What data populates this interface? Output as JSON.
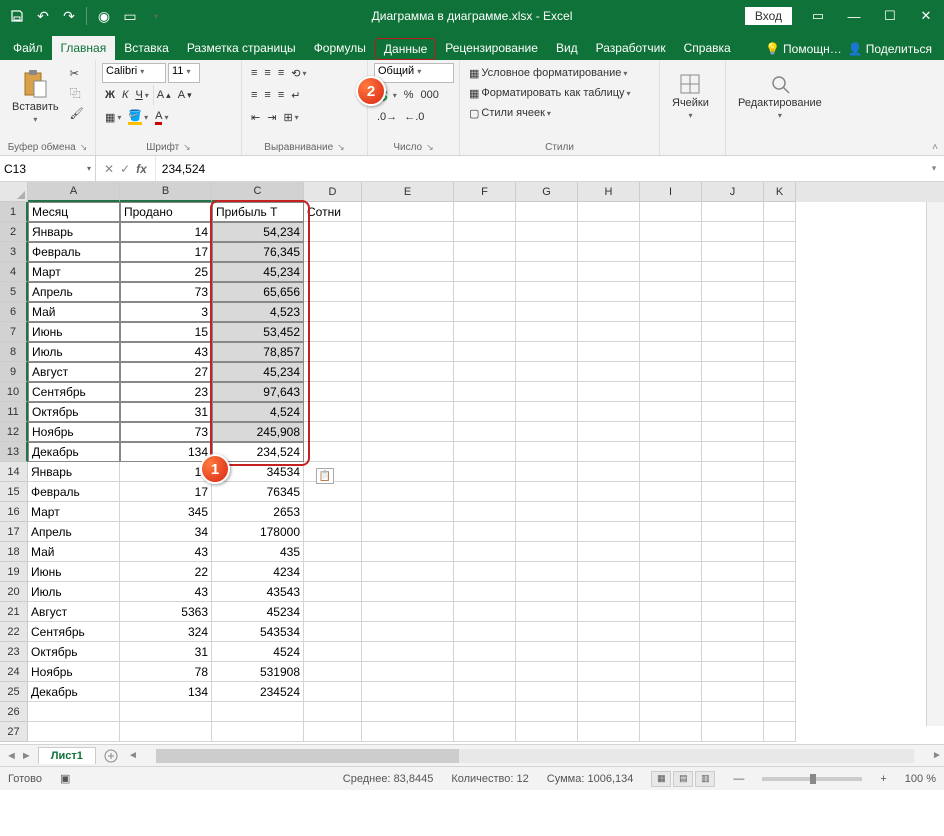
{
  "title": "Диаграмма в диаграмме.xlsx  -  Excel",
  "login": "Вход",
  "tabs": [
    "Файл",
    "Главная",
    "Вставка",
    "Разметка страницы",
    "Формулы",
    "Данные",
    "Рецензирование",
    "Вид",
    "Разработчик",
    "Справка"
  ],
  "active_tab": 1,
  "boxed_tab": 5,
  "help_label": "Помощн…",
  "share_label": "Поделиться",
  "ribbon": {
    "clipboard": {
      "paste": "Вставить",
      "label": "Буфер обмена"
    },
    "font": {
      "name": "Calibri",
      "size": "11",
      "label": "Шрифт"
    },
    "align": {
      "label": "Выравнивание"
    },
    "number": {
      "format": "Общий",
      "label": "Число"
    },
    "styles": {
      "cond": "Условное форматирование",
      "table": "Форматировать как таблицу",
      "cell": "Стили ячеек",
      "label": "Стили"
    },
    "cells": {
      "label": "Ячейки"
    },
    "editing": {
      "label": "Редактирование"
    }
  },
  "namebox": "C13",
  "formula": "234,524",
  "columns": [
    "A",
    "B",
    "C",
    "D",
    "E",
    "F",
    "G",
    "H",
    "I",
    "J",
    "K"
  ],
  "headers": {
    "A": "Месяц",
    "B": "Продано",
    "C": "Прибыль Т",
    "D": "Сотни"
  },
  "rows": [
    {
      "n": 1,
      "a": "Месяц",
      "b": "Продано",
      "c": "Прибыль Т",
      "d": "Сотни",
      "hdr": true
    },
    {
      "n": 2,
      "a": "Январь",
      "b": "14",
      "c": "54,234"
    },
    {
      "n": 3,
      "a": "Февраль",
      "b": "17",
      "c": "76,345"
    },
    {
      "n": 4,
      "a": "Март",
      "b": "25",
      "c": "45,234"
    },
    {
      "n": 5,
      "a": "Апрель",
      "b": "73",
      "c": "65,656"
    },
    {
      "n": 6,
      "a": "Май",
      "b": "3",
      "c": "4,523"
    },
    {
      "n": 7,
      "a": "Июнь",
      "b": "15",
      "c": "53,452"
    },
    {
      "n": 8,
      "a": "Июль",
      "b": "43",
      "c": "78,857"
    },
    {
      "n": 9,
      "a": "Август",
      "b": "27",
      "c": "45,234"
    },
    {
      "n": 10,
      "a": "Сентябрь",
      "b": "23",
      "c": "97,643"
    },
    {
      "n": 11,
      "a": "Октябрь",
      "b": "31",
      "c": "4,524"
    },
    {
      "n": 12,
      "a": "Ноябрь",
      "b": "73",
      "c": "245,908"
    },
    {
      "n": 13,
      "a": "Декабрь",
      "b": "134",
      "c": "234,524"
    },
    {
      "n": 14,
      "a": "Январь",
      "b": "14",
      "c": "34534"
    },
    {
      "n": 15,
      "a": "Февраль",
      "b": "17",
      "c": "76345"
    },
    {
      "n": 16,
      "a": "Март",
      "b": "345",
      "c": "2653"
    },
    {
      "n": 17,
      "a": "Апрель",
      "b": "34",
      "c": "178000"
    },
    {
      "n": 18,
      "a": "Май",
      "b": "43",
      "c": "435"
    },
    {
      "n": 19,
      "a": "Июнь",
      "b": "22",
      "c": "4234"
    },
    {
      "n": 20,
      "a": "Июль",
      "b": "43",
      "c": "43543"
    },
    {
      "n": 21,
      "a": "Август",
      "b": "5363",
      "c": "45234"
    },
    {
      "n": 22,
      "a": "Сентябрь",
      "b": "324",
      "c": "543534"
    },
    {
      "n": 23,
      "a": "Октябрь",
      "b": "31",
      "c": "4524"
    },
    {
      "n": 24,
      "a": "Ноябрь",
      "b": "78",
      "c": "531908"
    },
    {
      "n": 25,
      "a": "Декабрь",
      "b": "134",
      "c": "234524"
    }
  ],
  "sheet_name": "Лист1",
  "status": {
    "ready": "Готово",
    "avg_label": "Среднее:",
    "avg": "83,8445",
    "count_label": "Количество:",
    "count": "12",
    "sum_label": "Сумма:",
    "sum": "1006,134",
    "zoom": "100 %"
  },
  "badge1": "1",
  "badge2": "2"
}
